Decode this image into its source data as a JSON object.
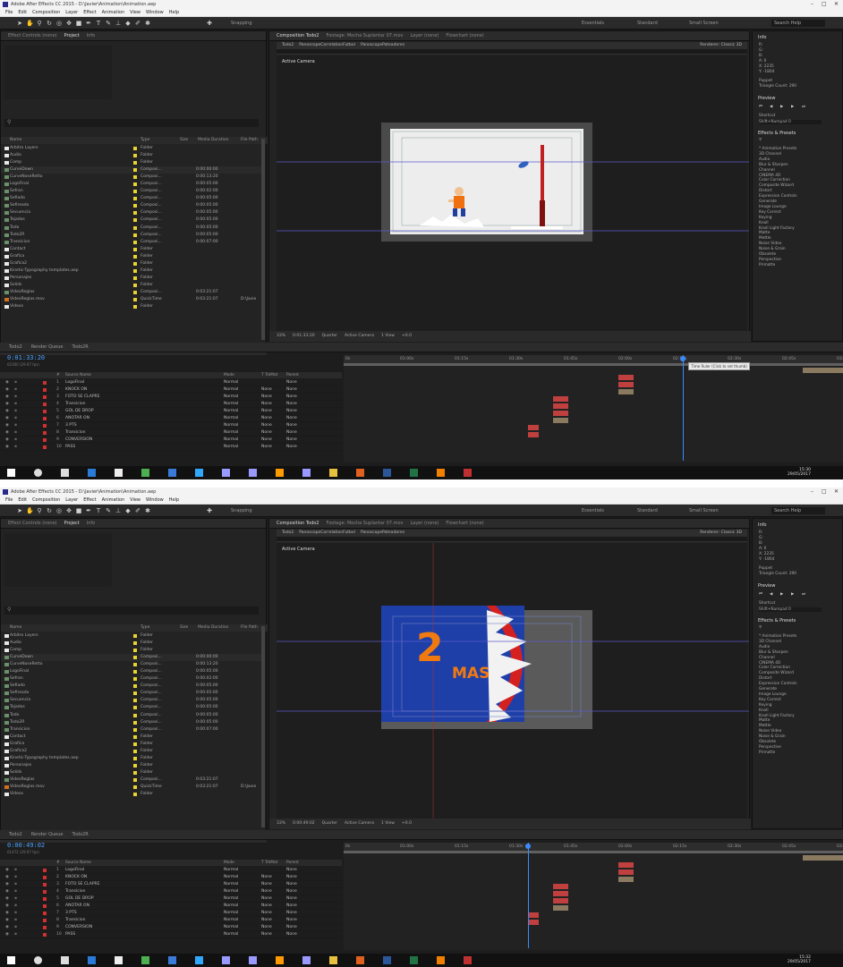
{
  "screens": [
    {
      "title": "Adobe After Effects CC 2015 - D:\\Javier\\Animation\\Animation.aep",
      "menu": [
        "File",
        "Edit",
        "Composition",
        "Layer",
        "Effect",
        "Animation",
        "View",
        "Window",
        "Help"
      ],
      "workspaces": [
        "Essentials",
        "Standard",
        "Small Screen"
      ],
      "search_help": "Search Help",
      "snapping": "Snapping",
      "panel_tabs": [
        "Effect Controls (none)",
        "Project",
        "Info",
        "Composition Todo2",
        "Footage: Mocha Suplantar 07.mov",
        "Layer (none)",
        "Flowchart (none)"
      ],
      "comp_subtabs": [
        "Todo2",
        "PanoscopeCorrelationFutbol",
        "PanoscopePateadores"
      ],
      "renderer": "Renderer: Classic 3D",
      "active_camera": "Active Camera",
      "project_columns": [
        "Name",
        "Type",
        "Size",
        "Media Duration",
        "File Path"
      ],
      "project_rows": [
        {
          "name": "Arbitro Layers",
          "icon": "folder",
          "type": "Folder",
          "dur": "",
          "extra": ""
        },
        {
          "name": "Audio",
          "icon": "folder",
          "type": "Folder",
          "dur": "",
          "extra": ""
        },
        {
          "name": "Comp",
          "icon": "folder",
          "type": "Folder",
          "dur": "",
          "extra": ""
        },
        {
          "name": "CurveDown",
          "icon": "comp",
          "type": "Composi...",
          "dur": "0:00:00:00",
          "extra": ""
        },
        {
          "name": "CurveNoseRetto",
          "icon": "comp",
          "type": "Composi...",
          "dur": "0:00:13:20",
          "extra": ""
        },
        {
          "name": "LogoFinal",
          "icon": "comp",
          "type": "Composi...",
          "dur": "0:00:05:00",
          "extra": ""
        },
        {
          "name": "Sefran",
          "icon": "comp",
          "type": "Composi...",
          "dur": "0:00:02:00",
          "extra": ""
        },
        {
          "name": "Sefiado",
          "icon": "comp",
          "type": "Composi...",
          "dur": "0:00:05:00",
          "extra": ""
        },
        {
          "name": "Sefireado",
          "icon": "comp",
          "type": "Composi...",
          "dur": "0:00:05:00",
          "extra": ""
        },
        {
          "name": "Secuencia",
          "icon": "comp",
          "type": "Composi...",
          "dur": "0:00:05:00",
          "extra": ""
        },
        {
          "name": "Tejados",
          "icon": "comp",
          "type": "Composi...",
          "dur": "0:00:05:00",
          "extra": ""
        },
        {
          "name": "Todo",
          "icon": "comp",
          "type": "Composi...",
          "dur": "0:00:05:00",
          "extra": ""
        },
        {
          "name": "Todo2R",
          "icon": "comp",
          "type": "Composi...",
          "dur": "0:00:05:00",
          "extra": ""
        },
        {
          "name": "Transicion",
          "icon": "comp",
          "type": "Composi...",
          "dur": "0:00:07:00",
          "extra": ""
        },
        {
          "name": "Contact",
          "icon": "folder",
          "type": "Folder",
          "dur": "",
          "extra": ""
        },
        {
          "name": "Grafica",
          "icon": "folder",
          "type": "Folder",
          "dur": "",
          "extra": ""
        },
        {
          "name": "Grafica2",
          "icon": "folder",
          "type": "Folder",
          "dur": "",
          "extra": ""
        },
        {
          "name": "Kinetic-Typography templates.aep",
          "icon": "folder",
          "type": "Folder",
          "dur": "",
          "extra": ""
        },
        {
          "name": "Personajes",
          "icon": "folder",
          "type": "Folder",
          "dur": "",
          "extra": ""
        },
        {
          "name": "Solids",
          "icon": "folder",
          "type": "Folder",
          "dur": "",
          "extra": ""
        },
        {
          "name": "VideoReglas",
          "icon": "comp",
          "type": "Composi...",
          "dur": "0:03:21:07",
          "extra": ""
        },
        {
          "name": "VideoReglas.mov",
          "icon": "file",
          "type": "QuickTime",
          "dur": "0:03:21:07",
          "extra": "D:\\Javie"
        },
        {
          "name": "Videos",
          "icon": "folder",
          "type": "Folder",
          "dur": "",
          "extra": ""
        }
      ],
      "project_footer": "8 bpc",
      "viewer_zoom": "33%",
      "viewer_time": "0:01:33:20",
      "viewer_quality": "Quarter",
      "viewer_cam": "Active Camera",
      "viewer_view": "1 View",
      "viewer_offset": "+0.0",
      "info_panel_title": "Info",
      "info_values": [
        "R:",
        "G:",
        "B:",
        "A: 0",
        "X: 2235",
        "Y: -1804"
      ],
      "puppet_text": "Puppet",
      "puppet_sub": "Triangle Count: 290",
      "preview_title": "Preview",
      "shortcut_label": "Shortcut",
      "shortcut_value": "Shift+Numpad 0",
      "effects_title": "Effects & Presets",
      "effects_items": [
        "* Animation Presets",
        "3D Channel",
        "Audio",
        "Blur & Sharpen",
        "Channel",
        "CINEMA 4D",
        "Color Correction",
        "Composite Wizard",
        "Distort",
        "Expression Controls",
        "Generate",
        "Image Lounge",
        "Key Correct",
        "Keying",
        "Knoll",
        "Knoll Light Factory",
        "Matte",
        "Mettle",
        "Noise Video",
        "Noise & Grain",
        "Obsolete",
        "Perspective",
        "Primatte"
      ],
      "timeline_tabs": [
        "Todo2",
        "Render Queue",
        "Todo2R"
      ],
      "timecode": "0:01:33:20",
      "timecode_sub": "02300 (29.97 fps)",
      "layer_cols": [
        "#",
        "Source Name",
        "Mode",
        "T TrkMat",
        "Parent"
      ],
      "layers": [
        {
          "n": "1",
          "name": "LogoFinal",
          "mode": "Normal",
          "trk": "",
          "parent": "None"
        },
        {
          "n": "2",
          "name": "KNOCK ON",
          "mode": "Normal",
          "trk": "None",
          "parent": "None"
        },
        {
          "n": "3",
          "name": "FOTO SE CLAPRE",
          "mode": "Normal",
          "trk": "None",
          "parent": "None"
        },
        {
          "n": "4",
          "name": "Transicion",
          "mode": "Normal",
          "trk": "None",
          "parent": "None"
        },
        {
          "n": "5",
          "name": "GOL DE DROP",
          "mode": "Normal",
          "trk": "None",
          "parent": "None"
        },
        {
          "n": "6",
          "name": "ANOTAR ON",
          "mode": "Normal",
          "trk": "None",
          "parent": "None"
        },
        {
          "n": "7",
          "name": "3 PTS",
          "mode": "Normal",
          "trk": "None",
          "parent": "None"
        },
        {
          "n": "8",
          "name": "Transicion",
          "mode": "Normal",
          "trk": "None",
          "parent": "None"
        },
        {
          "n": "9",
          "name": "CONVERSION",
          "mode": "Normal",
          "trk": "None",
          "parent": "None"
        },
        {
          "n": "10",
          "name": "PASS",
          "mode": "Normal",
          "trk": "None",
          "parent": "None"
        }
      ],
      "ruler_ticks": [
        "0s",
        "01:00s",
        "01:15s",
        "01:30s",
        "01:45s",
        "02:00s",
        "02:15s",
        "02:30s",
        "02:45s",
        "03:00s"
      ],
      "tooltip": "Time Ruler (Click to set thumb)",
      "clock": "15:30",
      "date": "29/05/2017",
      "playhead": 0.68
    },
    {
      "title": "Adobe After Effects CC 2015 - D:\\Javier\\Animation\\Animation.aep",
      "menu": [
        "File",
        "Edit",
        "Composition",
        "Layer",
        "Effect",
        "Animation",
        "View",
        "Window",
        "Help"
      ],
      "workspaces": [
        "Essentials",
        "Standard",
        "Small Screen"
      ],
      "search_help": "Search Help",
      "snapping": "Snapping",
      "panel_tabs": [
        "Effect Controls (none)",
        "Project",
        "Info",
        "Composition Todo2",
        "Footage: Mocha Suplantar 07.mov",
        "Layer (none)",
        "Flowchart (none)"
      ],
      "comp_subtabs": [
        "Todo2",
        "PanoscopeCorrelationFutbol",
        "PanoscopePateadores"
      ],
      "renderer": "Renderer: Classic 3D",
      "active_camera": "Active Camera",
      "project_columns": [
        "Name",
        "Type",
        "Size",
        "Media Duration",
        "File Path"
      ],
      "project_rows": [
        {
          "name": "Arbitro Layers",
          "icon": "folder",
          "type": "Folder",
          "dur": "",
          "extra": ""
        },
        {
          "name": "Audio",
          "icon": "folder",
          "type": "Folder",
          "dur": "",
          "extra": ""
        },
        {
          "name": "Comp",
          "icon": "folder",
          "type": "Folder",
          "dur": "",
          "extra": ""
        },
        {
          "name": "CurveDown",
          "icon": "comp",
          "type": "Composi...",
          "dur": "0:00:00:00",
          "extra": ""
        },
        {
          "name": "CurveNoseRetto",
          "icon": "comp",
          "type": "Composi...",
          "dur": "0:00:13:20",
          "extra": ""
        },
        {
          "name": "LogoFinal",
          "icon": "comp",
          "type": "Composi...",
          "dur": "0:00:05:00",
          "extra": ""
        },
        {
          "name": "Sefran",
          "icon": "comp",
          "type": "Composi...",
          "dur": "0:00:02:00",
          "extra": ""
        },
        {
          "name": "Sefiado",
          "icon": "comp",
          "type": "Composi...",
          "dur": "0:00:05:00",
          "extra": ""
        },
        {
          "name": "Sefireado",
          "icon": "comp",
          "type": "Composi...",
          "dur": "0:00:05:00",
          "extra": ""
        },
        {
          "name": "Secuencia",
          "icon": "comp",
          "type": "Composi...",
          "dur": "0:00:05:00",
          "extra": ""
        },
        {
          "name": "Tejados",
          "icon": "comp",
          "type": "Composi...",
          "dur": "0:00:05:00",
          "extra": ""
        },
        {
          "name": "Todo",
          "icon": "comp",
          "type": "Composi...",
          "dur": "0:00:05:00",
          "extra": ""
        },
        {
          "name": "Todo2R",
          "icon": "comp",
          "type": "Composi...",
          "dur": "0:00:05:00",
          "extra": ""
        },
        {
          "name": "Transicion",
          "icon": "comp",
          "type": "Composi...",
          "dur": "0:00:07:00",
          "extra": ""
        },
        {
          "name": "Contact",
          "icon": "folder",
          "type": "Folder",
          "dur": "",
          "extra": ""
        },
        {
          "name": "Grafica",
          "icon": "folder",
          "type": "Folder",
          "dur": "",
          "extra": ""
        },
        {
          "name": "Grafica2",
          "icon": "folder",
          "type": "Folder",
          "dur": "",
          "extra": ""
        },
        {
          "name": "Kinetic-Typography templates.aep",
          "icon": "folder",
          "type": "Folder",
          "dur": "",
          "extra": ""
        },
        {
          "name": "Personajes",
          "icon": "folder",
          "type": "Folder",
          "dur": "",
          "extra": ""
        },
        {
          "name": "Solids",
          "icon": "folder",
          "type": "Folder",
          "dur": "",
          "extra": ""
        },
        {
          "name": "VideoReglas",
          "icon": "comp",
          "type": "Composi...",
          "dur": "0:03:21:07",
          "extra": ""
        },
        {
          "name": "VideoReglas.mov",
          "icon": "file",
          "type": "QuickTime",
          "dur": "0:03:21:07",
          "extra": "D:\\Javie"
        },
        {
          "name": "Videos",
          "icon": "folder",
          "type": "Folder",
          "dur": "",
          "extra": ""
        }
      ],
      "project_footer": "8 bpc",
      "viewer_zoom": "33%",
      "viewer_time": "0:00:49:02",
      "viewer_quality": "Quarter",
      "viewer_cam": "Active Camera",
      "viewer_view": "1 View",
      "viewer_offset": "+0.0",
      "info_panel_title": "Info",
      "info_values": [
        "R:",
        "G:",
        "B:",
        "A: 0",
        "X: 2235",
        "Y: -1804"
      ],
      "puppet_text": "Puppet",
      "puppet_sub": "Triangle Count: 290",
      "preview_title": "Preview",
      "shortcut_label": "Shortcut",
      "shortcut_value": "Shift+Numpad 0",
      "effects_title": "Effects & Presets",
      "effects_items": [
        "* Animation Presets",
        "3D Channel",
        "Audio",
        "Blur & Sharpen",
        "Channel",
        "CINEMA 4D",
        "Color Correction",
        "Composite Wizard",
        "Distort",
        "Expression Controls",
        "Generate",
        "Image Lounge",
        "Key Correct",
        "Keying",
        "Knoll",
        "Knoll Light Factory",
        "Matte",
        "Mettle",
        "Noise Video",
        "Noise & Grain",
        "Obsolete",
        "Perspective",
        "Primatte"
      ],
      "timeline_tabs": [
        "Todo2",
        "Render Queue",
        "Todo2R"
      ],
      "timecode": "0:00:49:02",
      "timecode_sub": "01472 (29.97 fps)",
      "layer_cols": [
        "#",
        "Source Name",
        "Mode",
        "T TrkMat",
        "Parent"
      ],
      "layers": [
        {
          "n": "1",
          "name": "LogoFinal",
          "mode": "Normal",
          "trk": "",
          "parent": "None"
        },
        {
          "n": "2",
          "name": "KNOCK ON",
          "mode": "Normal",
          "trk": "None",
          "parent": "None"
        },
        {
          "n": "3",
          "name": "FOTO SE CLAPRE",
          "mode": "Normal",
          "trk": "None",
          "parent": "None"
        },
        {
          "n": "4",
          "name": "Transicion",
          "mode": "Normal",
          "trk": "None",
          "parent": "None"
        },
        {
          "n": "5",
          "name": "GOL DE DROP",
          "mode": "Normal",
          "trk": "None",
          "parent": "None"
        },
        {
          "n": "6",
          "name": "ANOTAR ON",
          "mode": "Normal",
          "trk": "None",
          "parent": "None"
        },
        {
          "n": "7",
          "name": "3 PTS",
          "mode": "Normal",
          "trk": "None",
          "parent": "None"
        },
        {
          "n": "8",
          "name": "Transicion",
          "mode": "Normal",
          "trk": "None",
          "parent": "None"
        },
        {
          "n": "9",
          "name": "CONVERSION",
          "mode": "Normal",
          "trk": "None",
          "parent": "None"
        },
        {
          "n": "10",
          "name": "PASS",
          "mode": "Normal",
          "trk": "None",
          "parent": "None"
        }
      ],
      "ruler_ticks": [
        "0s",
        "01:00s",
        "01:15s",
        "01:30s",
        "01:45s",
        "02:00s",
        "02:15s",
        "02:30s",
        "02:45s",
        "03:00s"
      ],
      "tooltip": "",
      "clock": "15:32",
      "date": "29/05/2017",
      "playhead": 0.37,
      "graphic_number": "2",
      "graphic_word": "MAS"
    }
  ]
}
